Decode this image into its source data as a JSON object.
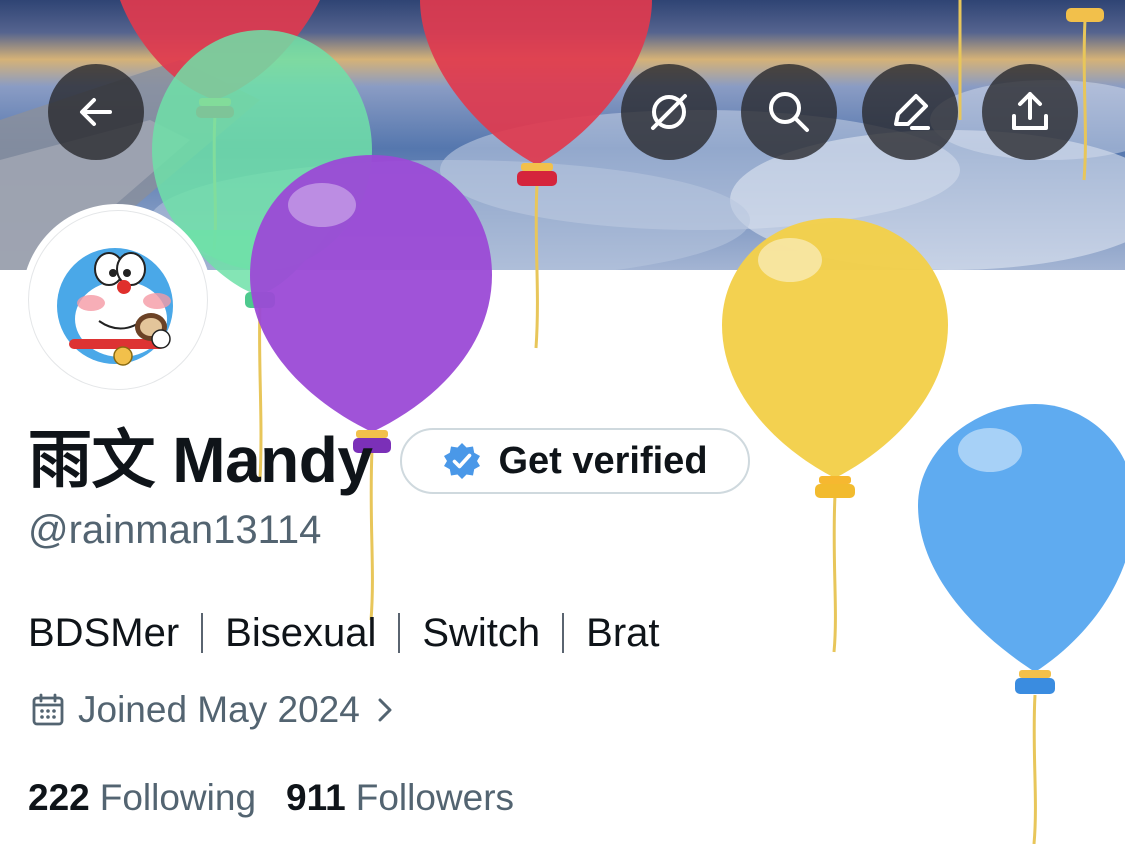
{
  "header": {
    "icons": [
      "back-arrow-icon",
      "grok-icon",
      "search-icon",
      "edit-icon",
      "share-icon"
    ]
  },
  "profile": {
    "name": "雨文 Mandy",
    "handle": "@rainman13114",
    "verify_label": "Get verified",
    "bio": [
      "BDSMer",
      "Bisexual",
      "Switch",
      "Brat"
    ],
    "joined": "Joined May 2024",
    "following_count": "222",
    "following_label": "Following",
    "followers_count": "911",
    "followers_label": "Followers"
  },
  "colors": {
    "verified_blue": "#4a98e8",
    "text_primary": "#0f1419",
    "text_secondary": "#536471",
    "balloon_red": "#e03a4e",
    "balloon_green": "#6fe0a8",
    "balloon_purple": "#9b4ad6",
    "balloon_yellow": "#f3cf4a",
    "balloon_blue": "#5aa8ef"
  }
}
